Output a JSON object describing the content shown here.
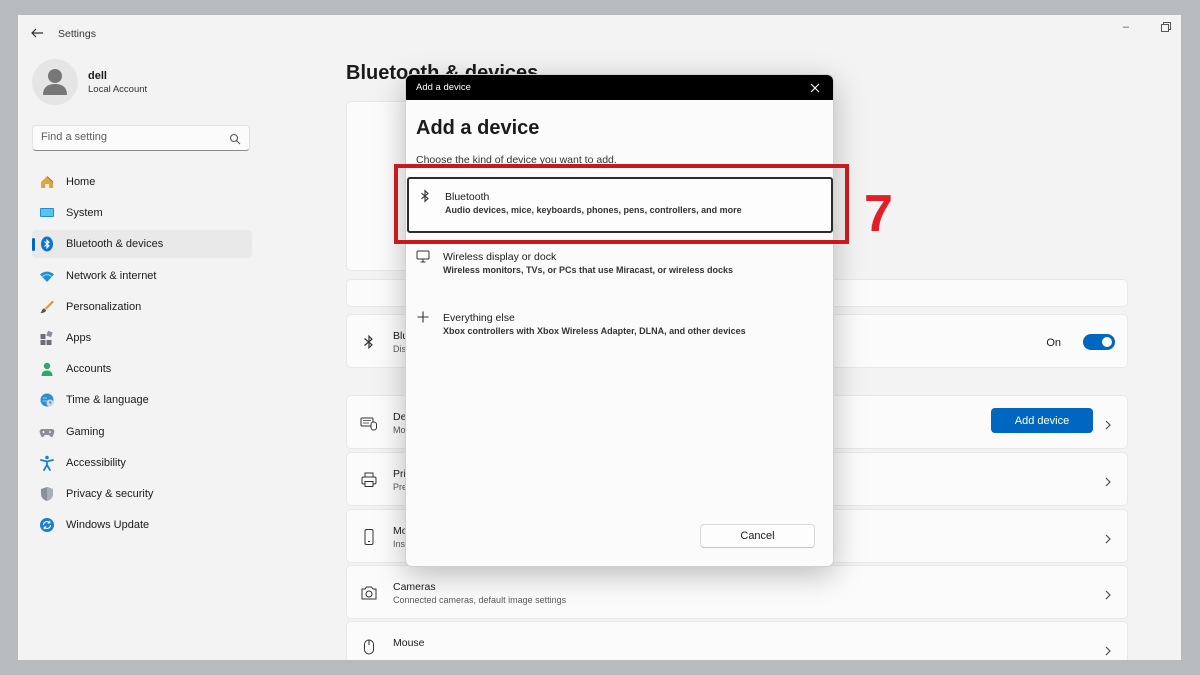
{
  "window": {
    "title": "Settings"
  },
  "profile": {
    "name": "dell",
    "account_type": "Local Account"
  },
  "search": {
    "placeholder": "Find a setting"
  },
  "nav": {
    "items": [
      {
        "label": "Home",
        "icon": "home-icon"
      },
      {
        "label": "System",
        "icon": "monitor-icon"
      },
      {
        "label": "Bluetooth & devices",
        "icon": "bluetooth-icon",
        "active": true
      },
      {
        "label": "Network & internet",
        "icon": "wifi-icon"
      },
      {
        "label": "Personalization",
        "icon": "brush-icon"
      },
      {
        "label": "Apps",
        "icon": "apps-icon"
      },
      {
        "label": "Accounts",
        "icon": "person-icon"
      },
      {
        "label": "Time & language",
        "icon": "globe-clock-icon"
      },
      {
        "label": "Gaming",
        "icon": "gamepad-icon"
      },
      {
        "label": "Accessibility",
        "icon": "accessibility-icon"
      },
      {
        "label": "Privacy & security",
        "icon": "shield-icon"
      },
      {
        "label": "Windows Update",
        "icon": "update-icon"
      }
    ]
  },
  "main": {
    "title": "Bluetooth & devices",
    "bluetooth": {
      "title": "Blu",
      "subtitle": "Dis",
      "state_label": "On",
      "enabled": true
    },
    "devices": {
      "title": "De",
      "subtitle": "Mo",
      "button_label": "Add device"
    },
    "printers": {
      "title": "Pri",
      "subtitle": "Pre"
    },
    "mobile": {
      "title": "Mo",
      "subtitle": "Ins"
    },
    "cameras": {
      "title": "Cameras",
      "subtitle": "Connected cameras, default image settings"
    },
    "mouse": {
      "title": "Mouse"
    }
  },
  "dialog": {
    "titlebar": "Add a device",
    "heading": "Add a device",
    "instruction": "Choose the kind of device you want to add.",
    "options": [
      {
        "title": "Bluetooth",
        "subtitle": "Audio devices, mice, keyboards, phones, pens, controllers, and more",
        "icon": "bluetooth-icon"
      },
      {
        "title": "Wireless display or dock",
        "subtitle": "Wireless monitors, TVs, or PCs that use Miracast, or wireless docks",
        "icon": "monitor-icon"
      },
      {
        "title": "Everything else",
        "subtitle": "Xbox controllers with Xbox Wireless Adapter, DLNA, and other devices",
        "icon": "plus-icon"
      }
    ],
    "cancel_label": "Cancel"
  },
  "annotation": {
    "step_number": "7",
    "color": "#e31e24"
  },
  "colors": {
    "accent": "#0067c0",
    "annotation": "#c8191e"
  }
}
